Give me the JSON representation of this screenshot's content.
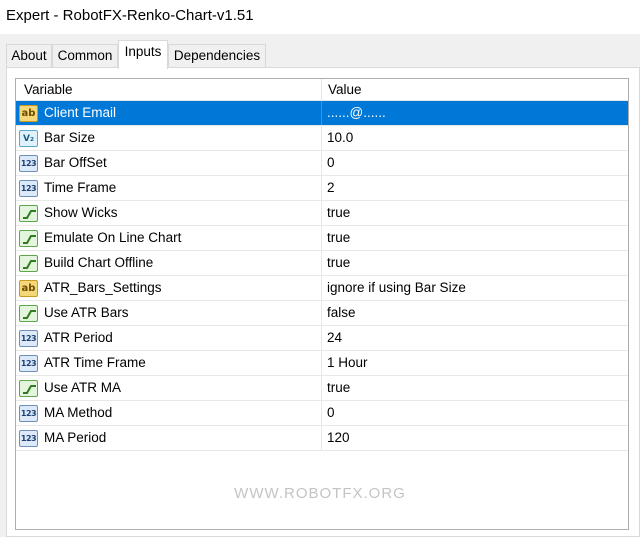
{
  "window": {
    "title": "Expert - RobotFX-Renko-Chart-v1.51"
  },
  "tabs": [
    {
      "label": "About"
    },
    {
      "label": "Common"
    },
    {
      "label": "Inputs"
    },
    {
      "label": "Dependencies"
    }
  ],
  "active_tab": "Inputs",
  "table": {
    "headers": {
      "variable": "Variable",
      "value": "Value"
    },
    "rows": [
      {
        "icon": "string-ab-icon",
        "variable": "Client Email",
        "value": "......@......",
        "selected": true
      },
      {
        "icon": "double-v2-icon",
        "variable": "Bar Size",
        "value": "10.0"
      },
      {
        "icon": "integer-123-icon",
        "variable": "Bar OffSet",
        "value": "0"
      },
      {
        "icon": "integer-123-icon",
        "variable": "Time Frame",
        "value": "2"
      },
      {
        "icon": "boolean-icon",
        "variable": "Show Wicks",
        "value": "true"
      },
      {
        "icon": "boolean-icon",
        "variable": "Emulate On Line Chart",
        "value": "true"
      },
      {
        "icon": "boolean-icon",
        "variable": "Build Chart Offline",
        "value": "true"
      },
      {
        "icon": "string-ab-icon",
        "variable": "ATR_Bars_Settings",
        "value": "ignore if using Bar Size"
      },
      {
        "icon": "boolean-icon",
        "variable": "Use ATR Bars",
        "value": "false"
      },
      {
        "icon": "integer-123-icon",
        "variable": "ATR Period",
        "value": "24"
      },
      {
        "icon": "integer-123-icon",
        "variable": "ATR Time Frame",
        "value": "1 Hour"
      },
      {
        "icon": "boolean-icon",
        "variable": "Use ATR MA",
        "value": "true"
      },
      {
        "icon": "integer-123-icon",
        "variable": "MA Method",
        "value": "0"
      },
      {
        "icon": "integer-123-icon",
        "variable": "MA Period",
        "value": "120"
      }
    ]
  },
  "icon_glyphs": {
    "ab": "ab",
    "v2": "V₂",
    "n123": "123"
  },
  "watermark": "WWW.ROBOTFX.ORG",
  "colors": {
    "selection": "#0078d7",
    "window_bg": "#f0f0f0",
    "grid_border": "#adadad"
  }
}
